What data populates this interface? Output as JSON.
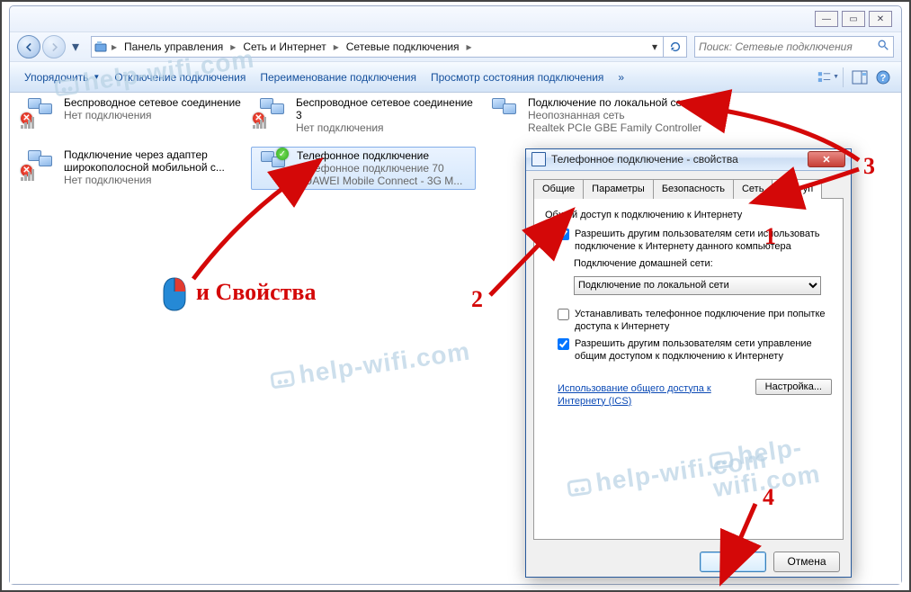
{
  "window_controls": {
    "minimize": "—",
    "maximize": "▭",
    "close": "✕"
  },
  "breadcrumbs": [
    "Панель управления",
    "Сеть и Интернет",
    "Сетевые подключения"
  ],
  "search": {
    "placeholder": "Поиск: Сетевые подключения"
  },
  "toolbar": {
    "organize": "Упорядочить",
    "disable": "Отключение подключения",
    "rename": "Переименование подключения",
    "status": "Просмотр состояния подключения"
  },
  "connections": [
    {
      "name": "Беспроводное сетевое соединение",
      "sub1": "",
      "sub2": "Нет подключения",
      "redx": true
    },
    {
      "name": "Беспроводное сетевое соединение 3",
      "sub1": "",
      "sub2": "Нет подключения",
      "redx": true
    },
    {
      "name": "Подключение по локальной сети",
      "sub1": "Неопознанная сеть",
      "sub2": "Realtek PCIe GBE Family Controller",
      "lan": true
    },
    {
      "name": "Подключение через адаптер широкополосной мобильной с...",
      "sub1": "",
      "sub2": "Нет подключения",
      "redx": true
    },
    {
      "name": "Телефонное подключение",
      "sub1": "Телефонное подключение 70",
      "sub2": "HUAWEI Mobile Connect - 3G M...",
      "selected": true,
      "check": true,
      "phone": true
    }
  ],
  "dialog": {
    "title": "Телефонное подключение - свойства",
    "tabs": [
      "Общие",
      "Параметры",
      "Безопасность",
      "Сеть",
      "Доступ"
    ],
    "active_tab": 4,
    "group": "Общий доступ к подключению к Интернету",
    "cb1": "Разрешить другим пользователям сети использовать подключение к Интернету данного компьютера",
    "home_label": "Подключение домашней сети:",
    "combo_value": "Подключение по локальной сети",
    "cb2": "Устанавливать телефонное подключение при попытке доступа к Интернету",
    "cb3": "Разрешить другим пользователям сети управление общим доступом к подключению к Интернету",
    "link": "Использование общего доступа к Интернету (ICS)",
    "settings_btn": "Настройка...",
    "ok": "ОК",
    "cancel": "Отмена"
  },
  "annotations": {
    "mouse_label": "и Свойства",
    "n1": "1",
    "n2": "2",
    "n3": "3",
    "n4": "4"
  },
  "watermark": "help-wifi.com"
}
